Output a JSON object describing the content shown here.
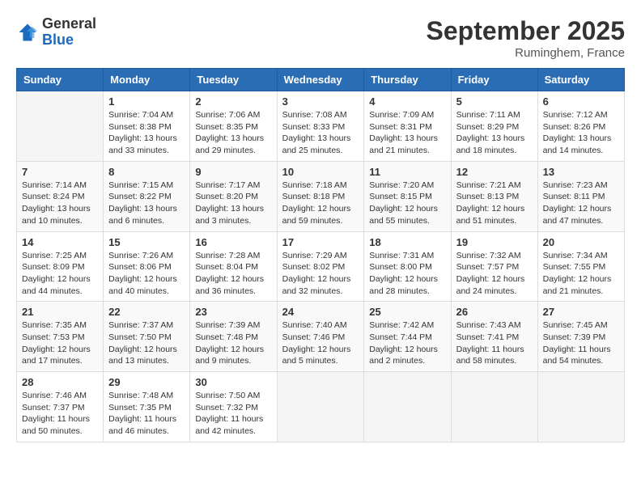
{
  "logo": {
    "general": "General",
    "blue": "Blue"
  },
  "title": "September 2025",
  "subtitle": "Ruminghem, France",
  "weekdays": [
    "Sunday",
    "Monday",
    "Tuesday",
    "Wednesday",
    "Thursday",
    "Friday",
    "Saturday"
  ],
  "weeks": [
    [
      {
        "day": "",
        "info": ""
      },
      {
        "day": "1",
        "info": "Sunrise: 7:04 AM\nSunset: 8:38 PM\nDaylight: 13 hours\nand 33 minutes."
      },
      {
        "day": "2",
        "info": "Sunrise: 7:06 AM\nSunset: 8:35 PM\nDaylight: 13 hours\nand 29 minutes."
      },
      {
        "day": "3",
        "info": "Sunrise: 7:08 AM\nSunset: 8:33 PM\nDaylight: 13 hours\nand 25 minutes."
      },
      {
        "day": "4",
        "info": "Sunrise: 7:09 AM\nSunset: 8:31 PM\nDaylight: 13 hours\nand 21 minutes."
      },
      {
        "day": "5",
        "info": "Sunrise: 7:11 AM\nSunset: 8:29 PM\nDaylight: 13 hours\nand 18 minutes."
      },
      {
        "day": "6",
        "info": "Sunrise: 7:12 AM\nSunset: 8:26 PM\nDaylight: 13 hours\nand 14 minutes."
      }
    ],
    [
      {
        "day": "7",
        "info": "Sunrise: 7:14 AM\nSunset: 8:24 PM\nDaylight: 13 hours\nand 10 minutes."
      },
      {
        "day": "8",
        "info": "Sunrise: 7:15 AM\nSunset: 8:22 PM\nDaylight: 13 hours\nand 6 minutes."
      },
      {
        "day": "9",
        "info": "Sunrise: 7:17 AM\nSunset: 8:20 PM\nDaylight: 13 hours\nand 3 minutes."
      },
      {
        "day": "10",
        "info": "Sunrise: 7:18 AM\nSunset: 8:18 PM\nDaylight: 12 hours\nand 59 minutes."
      },
      {
        "day": "11",
        "info": "Sunrise: 7:20 AM\nSunset: 8:15 PM\nDaylight: 12 hours\nand 55 minutes."
      },
      {
        "day": "12",
        "info": "Sunrise: 7:21 AM\nSunset: 8:13 PM\nDaylight: 12 hours\nand 51 minutes."
      },
      {
        "day": "13",
        "info": "Sunrise: 7:23 AM\nSunset: 8:11 PM\nDaylight: 12 hours\nand 47 minutes."
      }
    ],
    [
      {
        "day": "14",
        "info": "Sunrise: 7:25 AM\nSunset: 8:09 PM\nDaylight: 12 hours\nand 44 minutes."
      },
      {
        "day": "15",
        "info": "Sunrise: 7:26 AM\nSunset: 8:06 PM\nDaylight: 12 hours\nand 40 minutes."
      },
      {
        "day": "16",
        "info": "Sunrise: 7:28 AM\nSunset: 8:04 PM\nDaylight: 12 hours\nand 36 minutes."
      },
      {
        "day": "17",
        "info": "Sunrise: 7:29 AM\nSunset: 8:02 PM\nDaylight: 12 hours\nand 32 minutes."
      },
      {
        "day": "18",
        "info": "Sunrise: 7:31 AM\nSunset: 8:00 PM\nDaylight: 12 hours\nand 28 minutes."
      },
      {
        "day": "19",
        "info": "Sunrise: 7:32 AM\nSunset: 7:57 PM\nDaylight: 12 hours\nand 24 minutes."
      },
      {
        "day": "20",
        "info": "Sunrise: 7:34 AM\nSunset: 7:55 PM\nDaylight: 12 hours\nand 21 minutes."
      }
    ],
    [
      {
        "day": "21",
        "info": "Sunrise: 7:35 AM\nSunset: 7:53 PM\nDaylight: 12 hours\nand 17 minutes."
      },
      {
        "day": "22",
        "info": "Sunrise: 7:37 AM\nSunset: 7:50 PM\nDaylight: 12 hours\nand 13 minutes."
      },
      {
        "day": "23",
        "info": "Sunrise: 7:39 AM\nSunset: 7:48 PM\nDaylight: 12 hours\nand 9 minutes."
      },
      {
        "day": "24",
        "info": "Sunrise: 7:40 AM\nSunset: 7:46 PM\nDaylight: 12 hours\nand 5 minutes."
      },
      {
        "day": "25",
        "info": "Sunrise: 7:42 AM\nSunset: 7:44 PM\nDaylight: 12 hours\nand 2 minutes."
      },
      {
        "day": "26",
        "info": "Sunrise: 7:43 AM\nSunset: 7:41 PM\nDaylight: 11 hours\nand 58 minutes."
      },
      {
        "day": "27",
        "info": "Sunrise: 7:45 AM\nSunset: 7:39 PM\nDaylight: 11 hours\nand 54 minutes."
      }
    ],
    [
      {
        "day": "28",
        "info": "Sunrise: 7:46 AM\nSunset: 7:37 PM\nDaylight: 11 hours\nand 50 minutes."
      },
      {
        "day": "29",
        "info": "Sunrise: 7:48 AM\nSunset: 7:35 PM\nDaylight: 11 hours\nand 46 minutes."
      },
      {
        "day": "30",
        "info": "Sunrise: 7:50 AM\nSunset: 7:32 PM\nDaylight: 11 hours\nand 42 minutes."
      },
      {
        "day": "",
        "info": ""
      },
      {
        "day": "",
        "info": ""
      },
      {
        "day": "",
        "info": ""
      },
      {
        "day": "",
        "info": ""
      }
    ]
  ]
}
